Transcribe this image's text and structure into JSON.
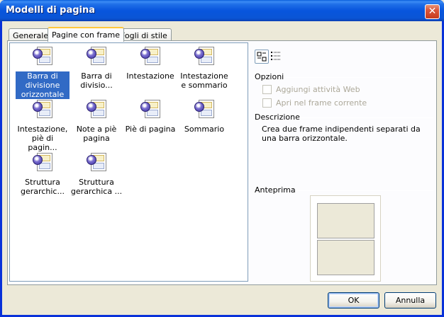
{
  "window": {
    "title": "Modelli di pagina"
  },
  "tabs": [
    {
      "label": "Generale"
    },
    {
      "label": "Pagine con frame"
    },
    {
      "label": "Fogli di stile"
    }
  ],
  "templates": [
    {
      "label": "Barra di divisione orizzontale",
      "selected": true
    },
    {
      "label": "Barra di divisio..."
    },
    {
      "label": "Intestazione"
    },
    {
      "label": "Intestazione e sommario"
    },
    {
      "label": "Intestazione, piè di pagin..."
    },
    {
      "label": "Note a piè pagina"
    },
    {
      "label": "Piè di pagina"
    },
    {
      "label": "Sommario"
    },
    {
      "label": "Struttura gerarchic..."
    },
    {
      "label": "Struttura gerarchica ..."
    }
  ],
  "options": {
    "heading": "Opzioni",
    "web_activity": {
      "label": "Aggiungi attività Web",
      "checked": false,
      "enabled": false
    },
    "open_in_frame": {
      "label": "Apri nel frame corrente",
      "checked": false,
      "enabled": false
    }
  },
  "description": {
    "heading": "Descrizione",
    "text": "Crea due frame indipendenti separati da una barra orizzontale."
  },
  "preview": {
    "heading": "Anteprima"
  },
  "buttons": {
    "ok": "OK",
    "cancel": "Annulla"
  },
  "icons": {
    "large_icons_view": "large-icons-view-icon",
    "list_view": "list-view-icon",
    "template": "frame-page-icon",
    "close": "close-icon"
  },
  "colors": {
    "selection": "#316ac5",
    "titlebar": "#0855dd",
    "tab_highlight": "#ffc83c"
  }
}
